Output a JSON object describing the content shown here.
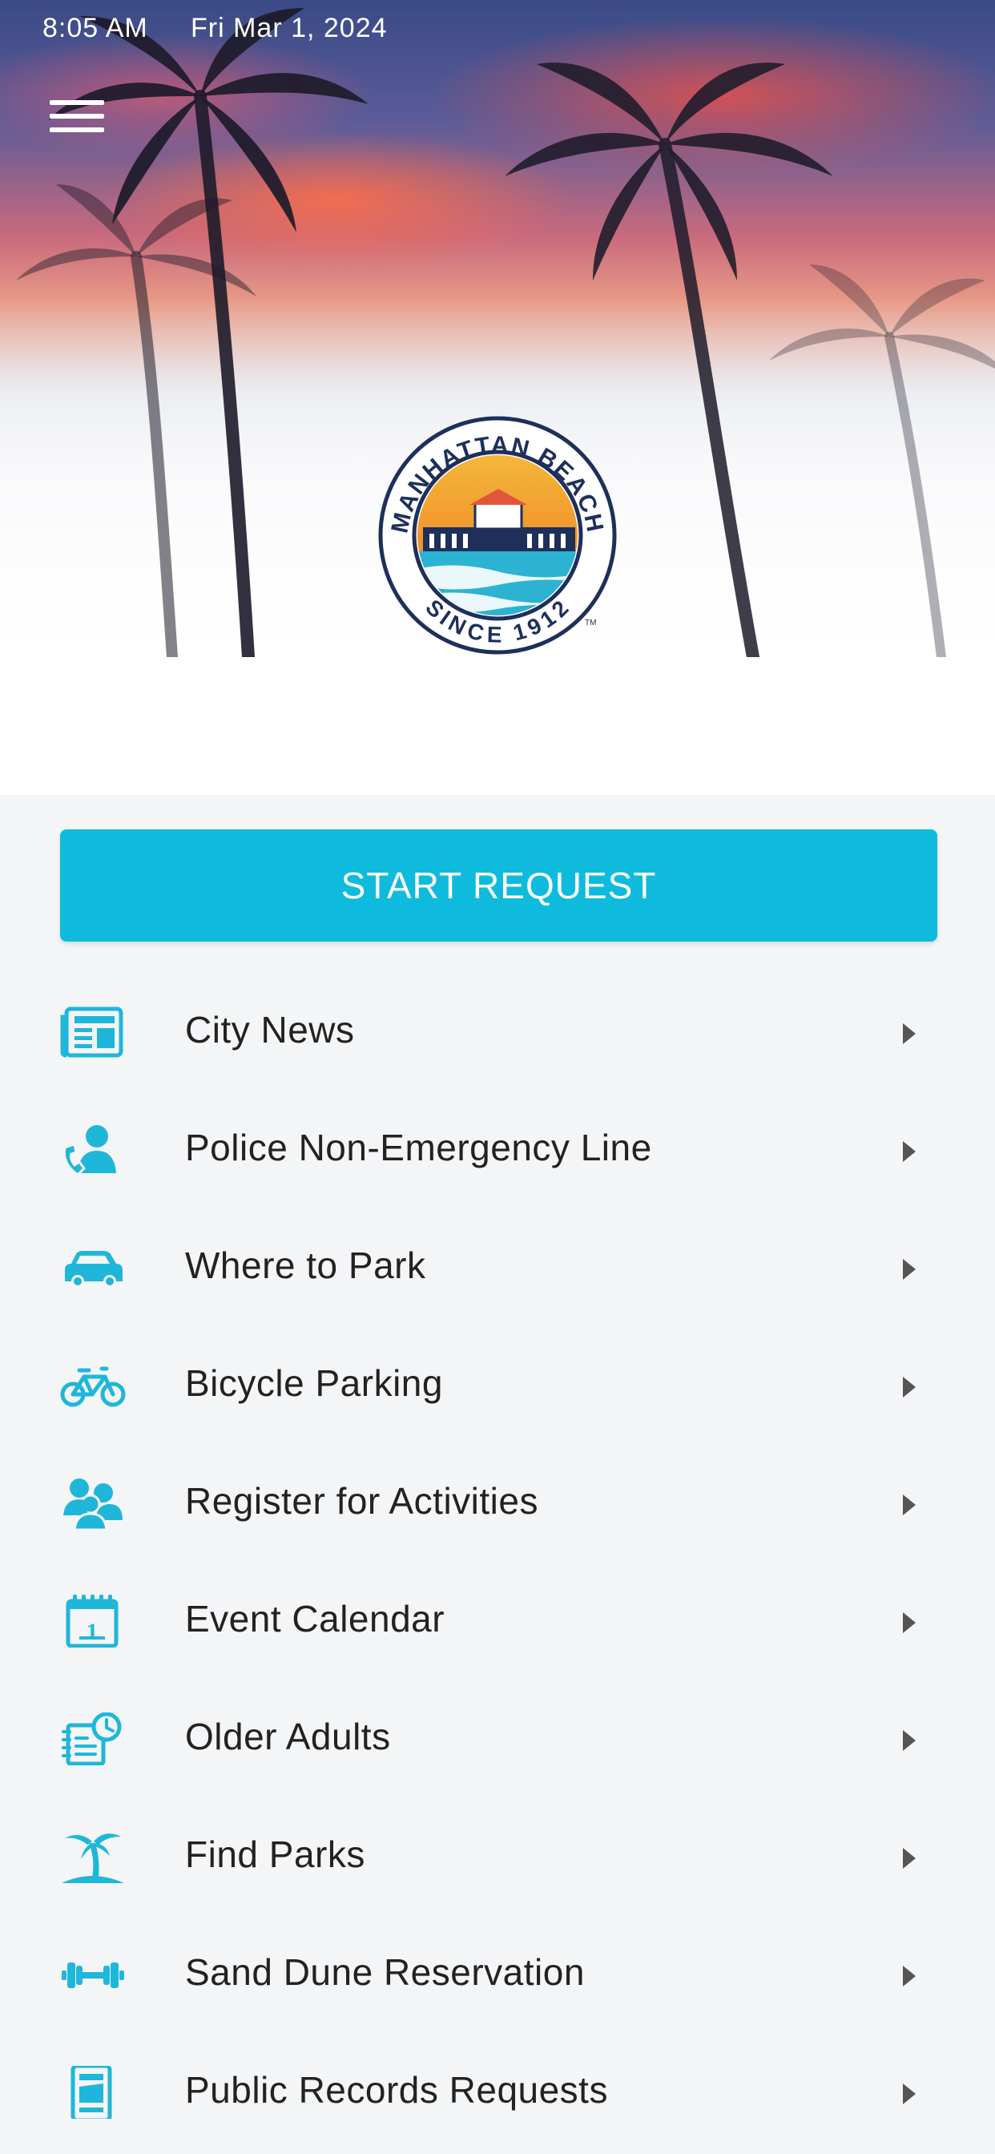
{
  "status": {
    "time": "8:05 AM",
    "date": "Fri Mar 1, 2024"
  },
  "header": {
    "menu_icon": "hamburger-menu-icon"
  },
  "logo": {
    "top_text": "MANHATTAN BEACH",
    "bottom_text": "SINCE 1912",
    "tm": "TM"
  },
  "start_request": {
    "label": "START REQUEST"
  },
  "colors": {
    "accent": "#0fbbdc",
    "text": "#222222",
    "background": "#f4f5f7"
  },
  "menu": {
    "items": [
      {
        "label": "City News",
        "icon": "newspaper-icon"
      },
      {
        "label": "Police Non-Emergency Line",
        "icon": "person-phone-icon"
      },
      {
        "label": "Where to Park",
        "icon": "car-icon"
      },
      {
        "label": "Bicycle Parking",
        "icon": "bicycle-icon"
      },
      {
        "label": "Register for Activities",
        "icon": "people-group-icon"
      },
      {
        "label": "Event Calendar",
        "icon": "calendar-icon"
      },
      {
        "label": "Older Adults",
        "icon": "notebook-clock-icon"
      },
      {
        "label": "Find Parks",
        "icon": "palm-tree-icon"
      },
      {
        "label": "Sand Dune Reservation",
        "icon": "dumbbell-icon"
      },
      {
        "label": "Public Records Requests",
        "icon": "records-box-icon"
      }
    ]
  }
}
